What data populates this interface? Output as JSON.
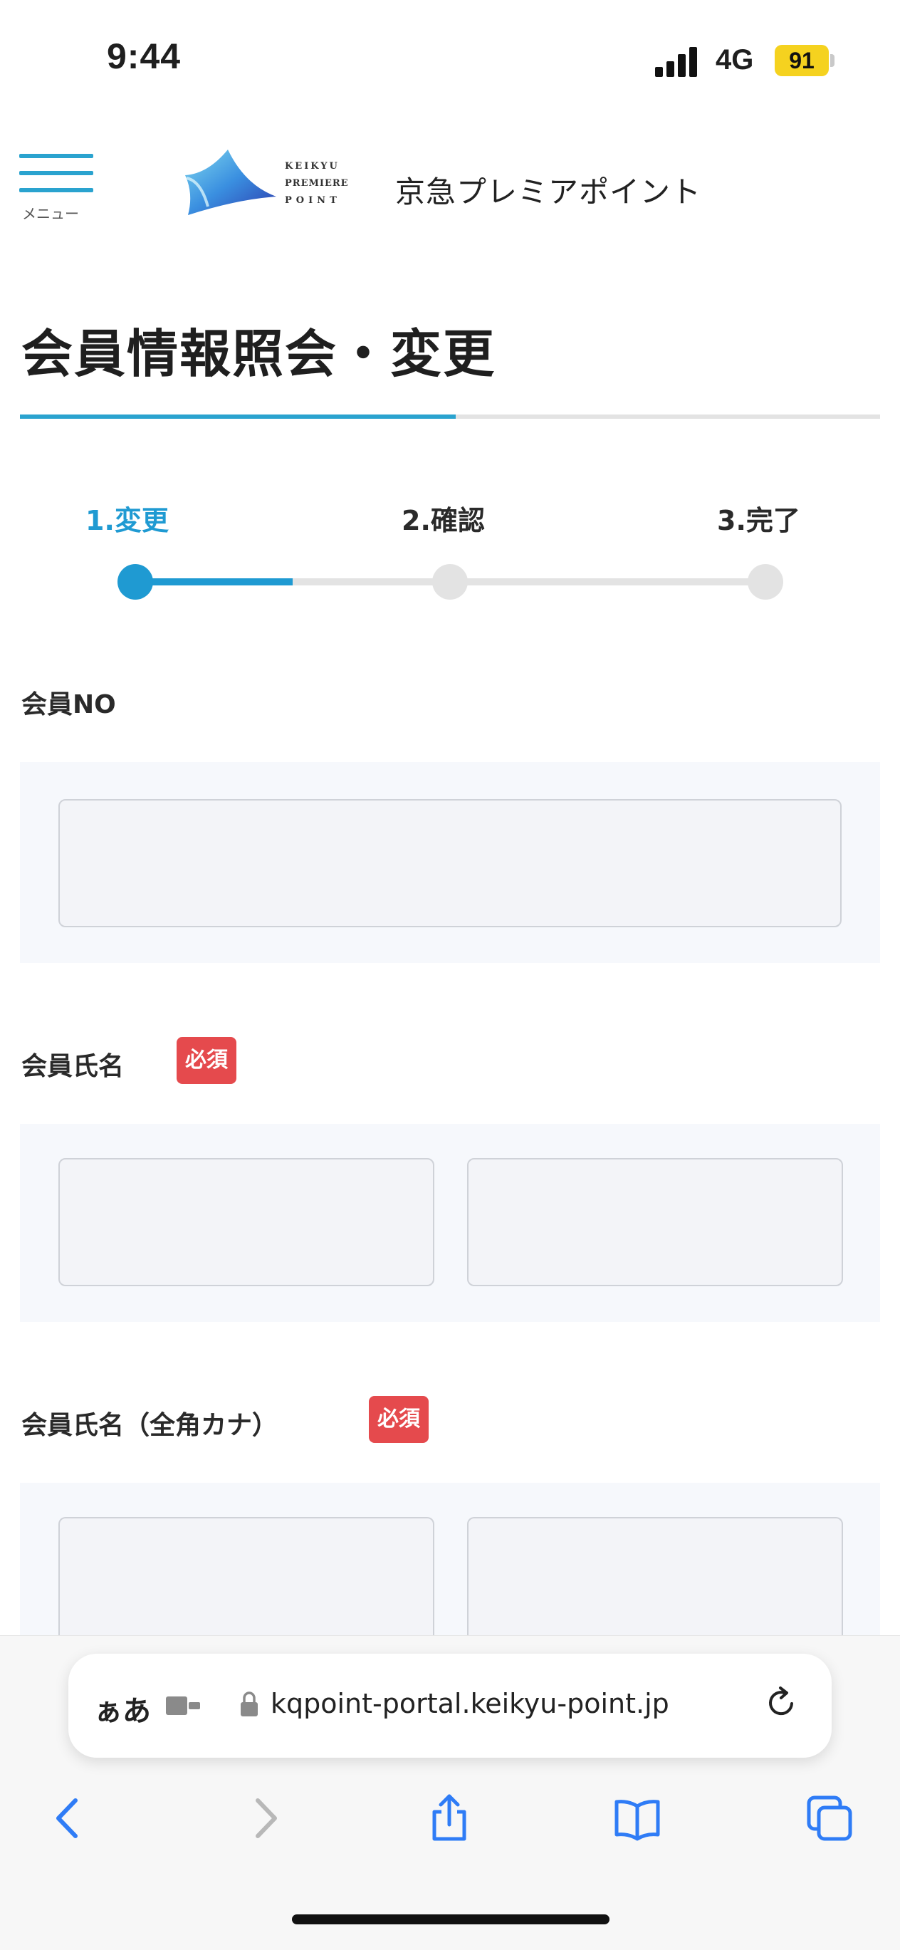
{
  "status_bar": {
    "time": "9:44",
    "network": "4G",
    "battery": "91",
    "battery_color": "#f5d21f"
  },
  "header": {
    "menu_label": "メニュー",
    "logo_lines": [
      "KEIKYU",
      "PREMIERE",
      "POINT"
    ],
    "brand_name": "京急プレミアポイント"
  },
  "page": {
    "title": "会員情報照会・変更",
    "accent_color": "#2aa3cf"
  },
  "stepper": {
    "steps": [
      {
        "label": "1.変更",
        "active": true
      },
      {
        "label": "2.確認",
        "active": false
      },
      {
        "label": "3.完了",
        "active": false
      }
    ],
    "progress": 0.25
  },
  "form": {
    "member_no": {
      "label": "会員NO",
      "value": ""
    },
    "member_name": {
      "label": "会員氏名",
      "required_badge": "必須",
      "last_value": "",
      "first_value": ""
    },
    "member_name_kana": {
      "label": "会員氏名（全角カナ）",
      "required_badge": "必須",
      "last_value": "",
      "first_value": ""
    },
    "required_color": "#e54a4d"
  },
  "browser": {
    "text_size_label": "ぁあ",
    "url": "kqpoint-portal.keikyu-point.jp",
    "icons": [
      "back-icon",
      "forward-icon",
      "share-icon",
      "bookmarks-icon",
      "tabs-icon",
      "reload-icon",
      "lock-icon",
      "extension-icon"
    ]
  }
}
